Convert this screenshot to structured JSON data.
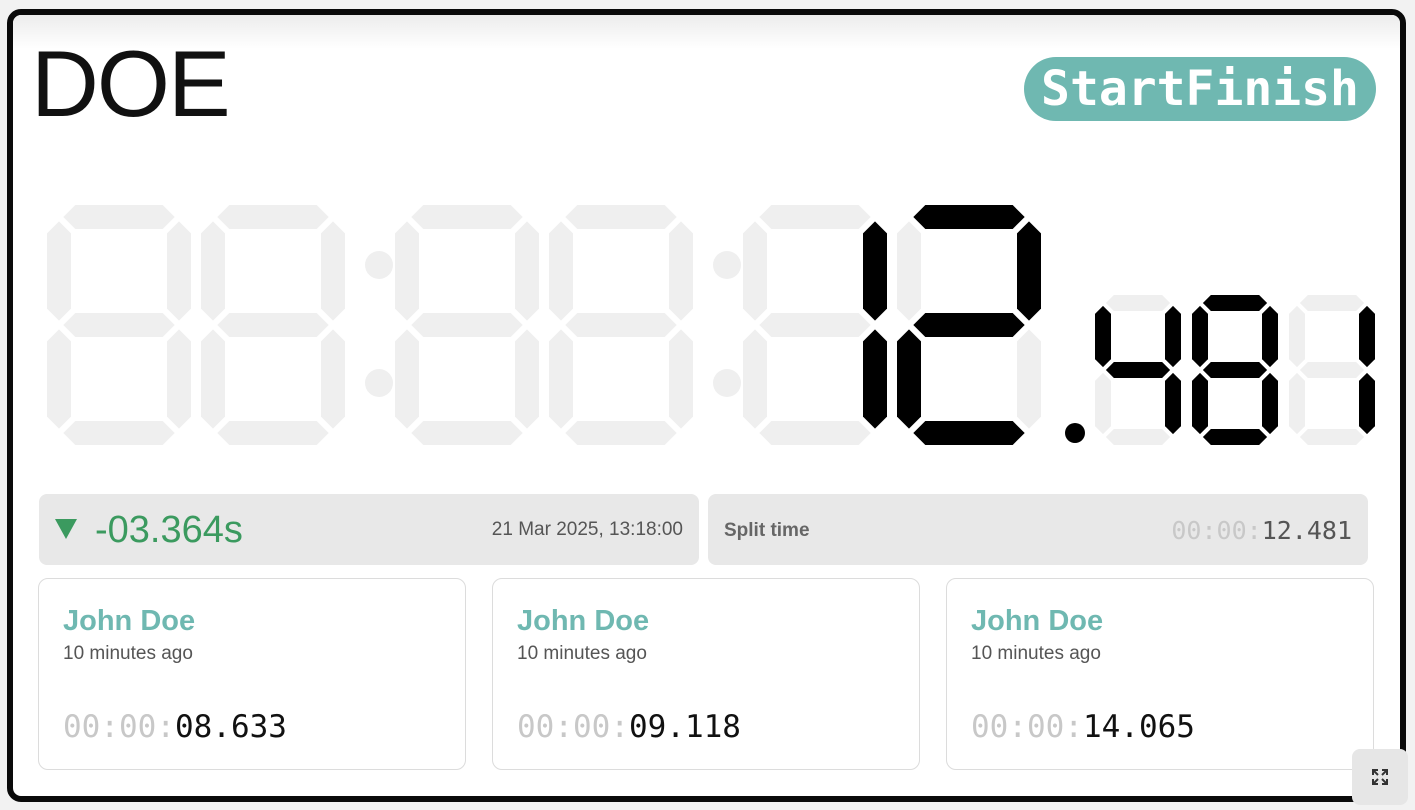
{
  "athlete": {
    "name": "DOE"
  },
  "brand": {
    "label": "StartFinish",
    "color": "#6fb8b1"
  },
  "clock": {
    "display": "12.481",
    "slots": [
      {
        "type": "big",
        "char": ""
      },
      {
        "type": "big",
        "char": ""
      },
      {
        "type": "colon"
      },
      {
        "type": "big",
        "char": ""
      },
      {
        "type": "big",
        "char": ""
      },
      {
        "type": "colon"
      },
      {
        "type": "big",
        "char": "1"
      },
      {
        "type": "big",
        "char": "2"
      },
      {
        "type": "dot"
      },
      {
        "type": "small",
        "char": "4"
      },
      {
        "type": "small",
        "char": "8"
      },
      {
        "type": "small",
        "char": "1"
      }
    ],
    "colors": {
      "on": "#000000",
      "off": "#efefef"
    }
  },
  "difference": {
    "value": "-03.364s",
    "timestamp": "21 Mar 2025, 13:18:00",
    "direction_icon": "down-triangle-icon",
    "color": "#3b9a5f"
  },
  "split": {
    "label": "Split time",
    "time_dim": "00:00:",
    "time_main": "12.481"
  },
  "results": [
    {
      "name": "John Doe",
      "ago": "10 minutes ago",
      "time_dim": "00:00:",
      "time_main": "08.633"
    },
    {
      "name": "John Doe",
      "ago": "10 minutes ago",
      "time_dim": "00:00:",
      "time_main": "09.118"
    },
    {
      "name": "John Doe",
      "ago": "10 minutes ago",
      "time_dim": "00:00:",
      "time_main": "14.065"
    }
  ],
  "controls": {
    "expand_icon": "expand-icon"
  }
}
